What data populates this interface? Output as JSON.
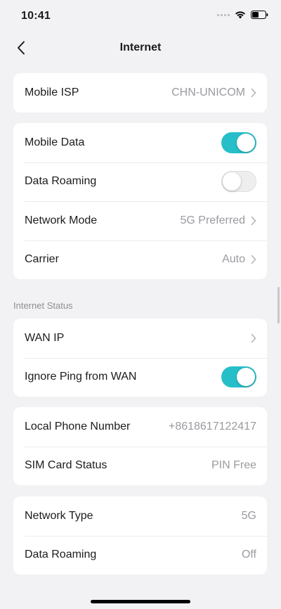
{
  "status_bar": {
    "time": "10:41"
  },
  "nav": {
    "title": "Internet"
  },
  "isp_card": {
    "label": "Mobile ISP",
    "value": "CHN-UNICOM"
  },
  "data_card": {
    "mobile_data": {
      "label": "Mobile Data",
      "enabled": true
    },
    "data_roaming": {
      "label": "Data Roaming",
      "enabled": false
    },
    "network_mode": {
      "label": "Network Mode",
      "value": "5G Preferred"
    },
    "carrier": {
      "label": "Carrier",
      "value": "Auto"
    }
  },
  "internet_status": {
    "section_label": "Internet Status",
    "wan_ip": {
      "label": "WAN IP"
    },
    "ignore_ping": {
      "label": "Ignore Ping from WAN",
      "enabled": true
    }
  },
  "phone_card": {
    "local_phone": {
      "label": "Local Phone Number",
      "value": "+8618617122417"
    },
    "sim_status": {
      "label": "SIM Card Status",
      "value": "PIN Free"
    }
  },
  "network_card": {
    "network_type": {
      "label": "Network Type",
      "value": "5G"
    },
    "data_roaming": {
      "label": "Data Roaming",
      "value": "Off"
    }
  },
  "colors": {
    "accent_toggle": "#26bfc9",
    "background": "#f2f2f4",
    "card": "#ffffff",
    "secondary_text": "#9a9aa0"
  },
  "icons": {
    "back": "chevron-left-icon",
    "disclosure": "chevron-right-icon",
    "wifi": "wifi-icon",
    "battery": "battery-icon"
  }
}
